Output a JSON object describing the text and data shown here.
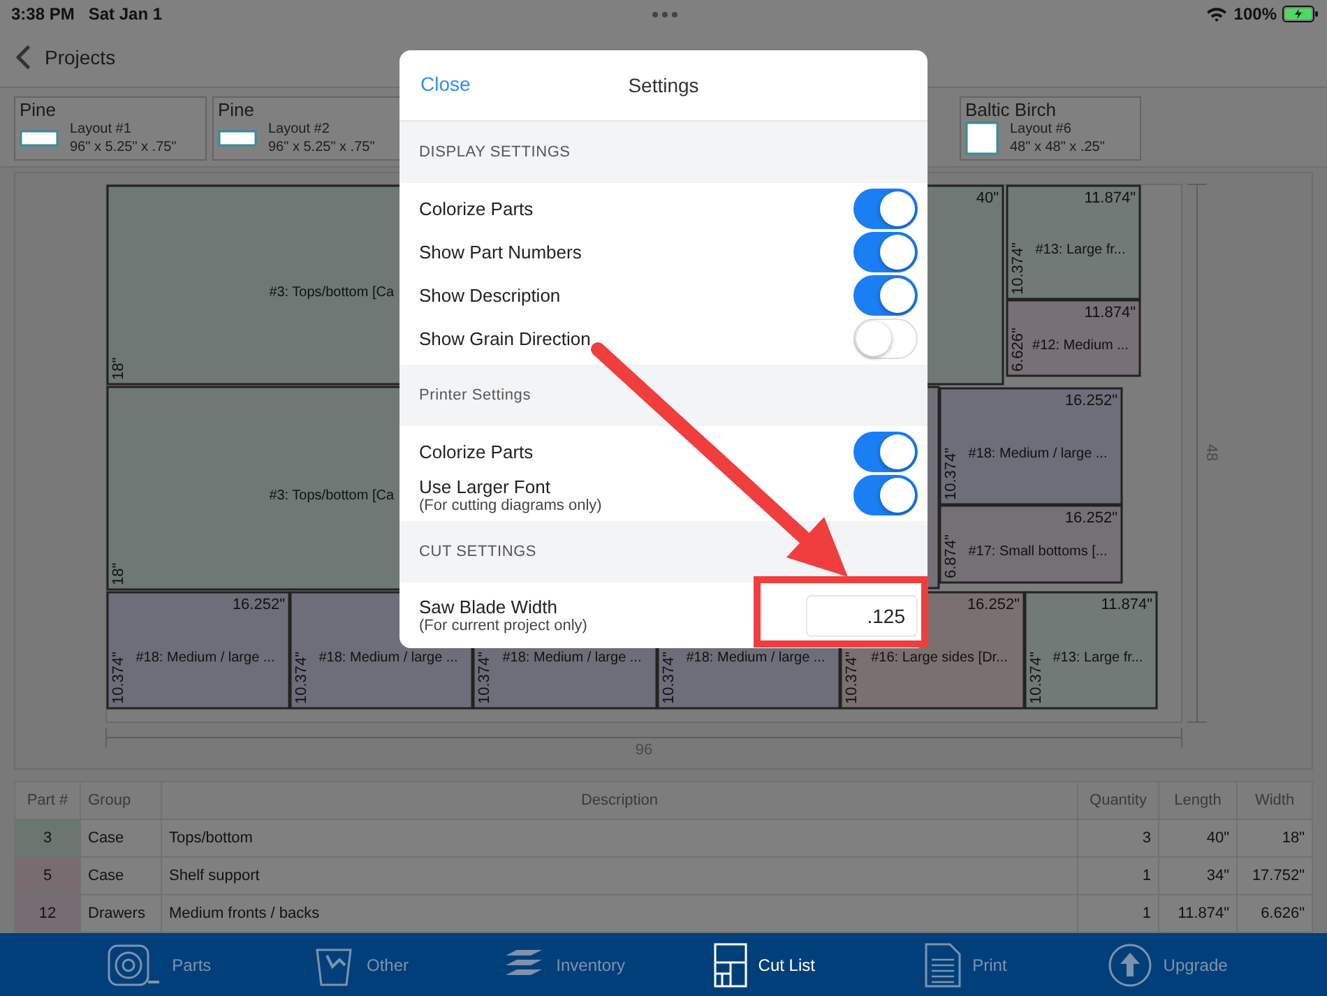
{
  "status_bar": {
    "time": "3:38 PM",
    "date": "Sat Jan 1",
    "battery": "100%"
  },
  "nav": {
    "back_label": "Projects"
  },
  "layouts": [
    {
      "material": "Pine",
      "name": "Layout #1",
      "size": "96\" x 5.25\" x .75\"",
      "kind": "strip"
    },
    {
      "material": "Pine",
      "name": "Layout #2",
      "size": "96\" x 5.25\" x .75\"",
      "kind": "strip"
    },
    {
      "material": "Baltic Birch",
      "name": "Layout #6",
      "size": "48\" x 48\" x .25\"",
      "kind": "square"
    }
  ],
  "diagram": {
    "sheet_width_label": "96",
    "sheet_height_label": "48",
    "parts": [
      {
        "label": "#3: Tops/bottom [Ca",
        "height_label": "18\"",
        "color": "#6e7874"
      },
      {
        "width_label": "40\"",
        "color": "#6e7874"
      },
      {
        "label": "#13: Large fr...",
        "width_label": "11.874\"",
        "height_label": "10.374\"",
        "color": "#717a76"
      },
      {
        "label": "#12: Medium ...",
        "width_label": "11.874\"",
        "height_label": "6.626\"",
        "color": "#787077"
      },
      {
        "label": "#3: Tops/bottom [Ca",
        "height_label": "18\"",
        "color": "#6e7874"
      },
      {
        "color": "#737077"
      },
      {
        "label": "#18: Medium / large ...",
        "width_label": "16.252\"",
        "height_label": "10.374\"",
        "color": "#6d6e79"
      },
      {
        "label": "#17: Small bottoms [...",
        "width_label": "16.252\"",
        "height_label": "6.874\"",
        "color": "#757076"
      },
      {
        "label": "#18: Medium / large ...",
        "width_label": "16.252\"",
        "height_label": "10.374\"",
        "color": "#6d6e79"
      },
      {
        "label": "#18: Medium / large ...",
        "height_label": "10.374\"",
        "color": "#6d6e79"
      },
      {
        "label": "#18: Medium / large ...",
        "height_label": "10.374\"",
        "color": "#6d6e79"
      },
      {
        "label": "#18: Medium / large ...",
        "height_label": "10.374\"",
        "color": "#6d6e79"
      },
      {
        "label": "#16: Large sides [Dr...",
        "width_label": "16.252\"",
        "height_label": "10.374\"",
        "color": "#7b7070"
      },
      {
        "label": "#13: Large fr...",
        "width_label": "11.874\"",
        "height_label": "10.374\"",
        "color": "#717a76"
      }
    ]
  },
  "table": {
    "columns": [
      "Part #",
      "Group",
      "Description",
      "Quantity",
      "Length",
      "Width"
    ],
    "rows": [
      {
        "part": "3",
        "group": "Case",
        "description": "Tops/bottom",
        "quantity": "3",
        "length": "40\"",
        "width": "18\"",
        "color": "#6b7671"
      },
      {
        "part": "5",
        "group": "Case",
        "description": "Shelf support",
        "quantity": "1",
        "length": "34\"",
        "width": "17.752\"",
        "color": "#786c71"
      },
      {
        "part": "12",
        "group": "Drawers",
        "description": "Medium fronts / backs",
        "quantity": "1",
        "length": "11.874\"",
        "width": "6.626\"",
        "color": "#766c72"
      }
    ]
  },
  "tab_bar": [
    {
      "label": "Parts",
      "selected": false
    },
    {
      "label": "Other",
      "selected": false
    },
    {
      "label": "Inventory",
      "selected": false
    },
    {
      "label": "Cut List",
      "selected": true
    },
    {
      "label": "Print",
      "selected": false
    },
    {
      "label": "Upgrade",
      "selected": false
    }
  ],
  "settings": {
    "close": "Close",
    "title": "Settings",
    "sections": [
      {
        "title": "DISPLAY SETTINGS",
        "rows": [
          {
            "kind": "toggle",
            "label": "Colorize Parts",
            "on": true
          },
          {
            "kind": "toggle",
            "label": "Show Part Numbers",
            "on": true
          },
          {
            "kind": "toggle",
            "label": "Show Description",
            "on": true
          },
          {
            "kind": "toggle",
            "label": "Show Grain Direction",
            "on": false
          }
        ]
      },
      {
        "title": "Printer Settings",
        "rows": [
          {
            "kind": "toggle",
            "label": "Colorize Parts",
            "on": true
          },
          {
            "kind": "toggle",
            "label": "Use Larger Font",
            "note": "(For cutting diagrams only)",
            "on": true
          }
        ]
      },
      {
        "title": "CUT SETTINGS",
        "rows": [
          {
            "kind": "input",
            "label": "Saw Blade Width",
            "note": "(For current project only)",
            "value": ".125"
          }
        ]
      }
    ]
  }
}
